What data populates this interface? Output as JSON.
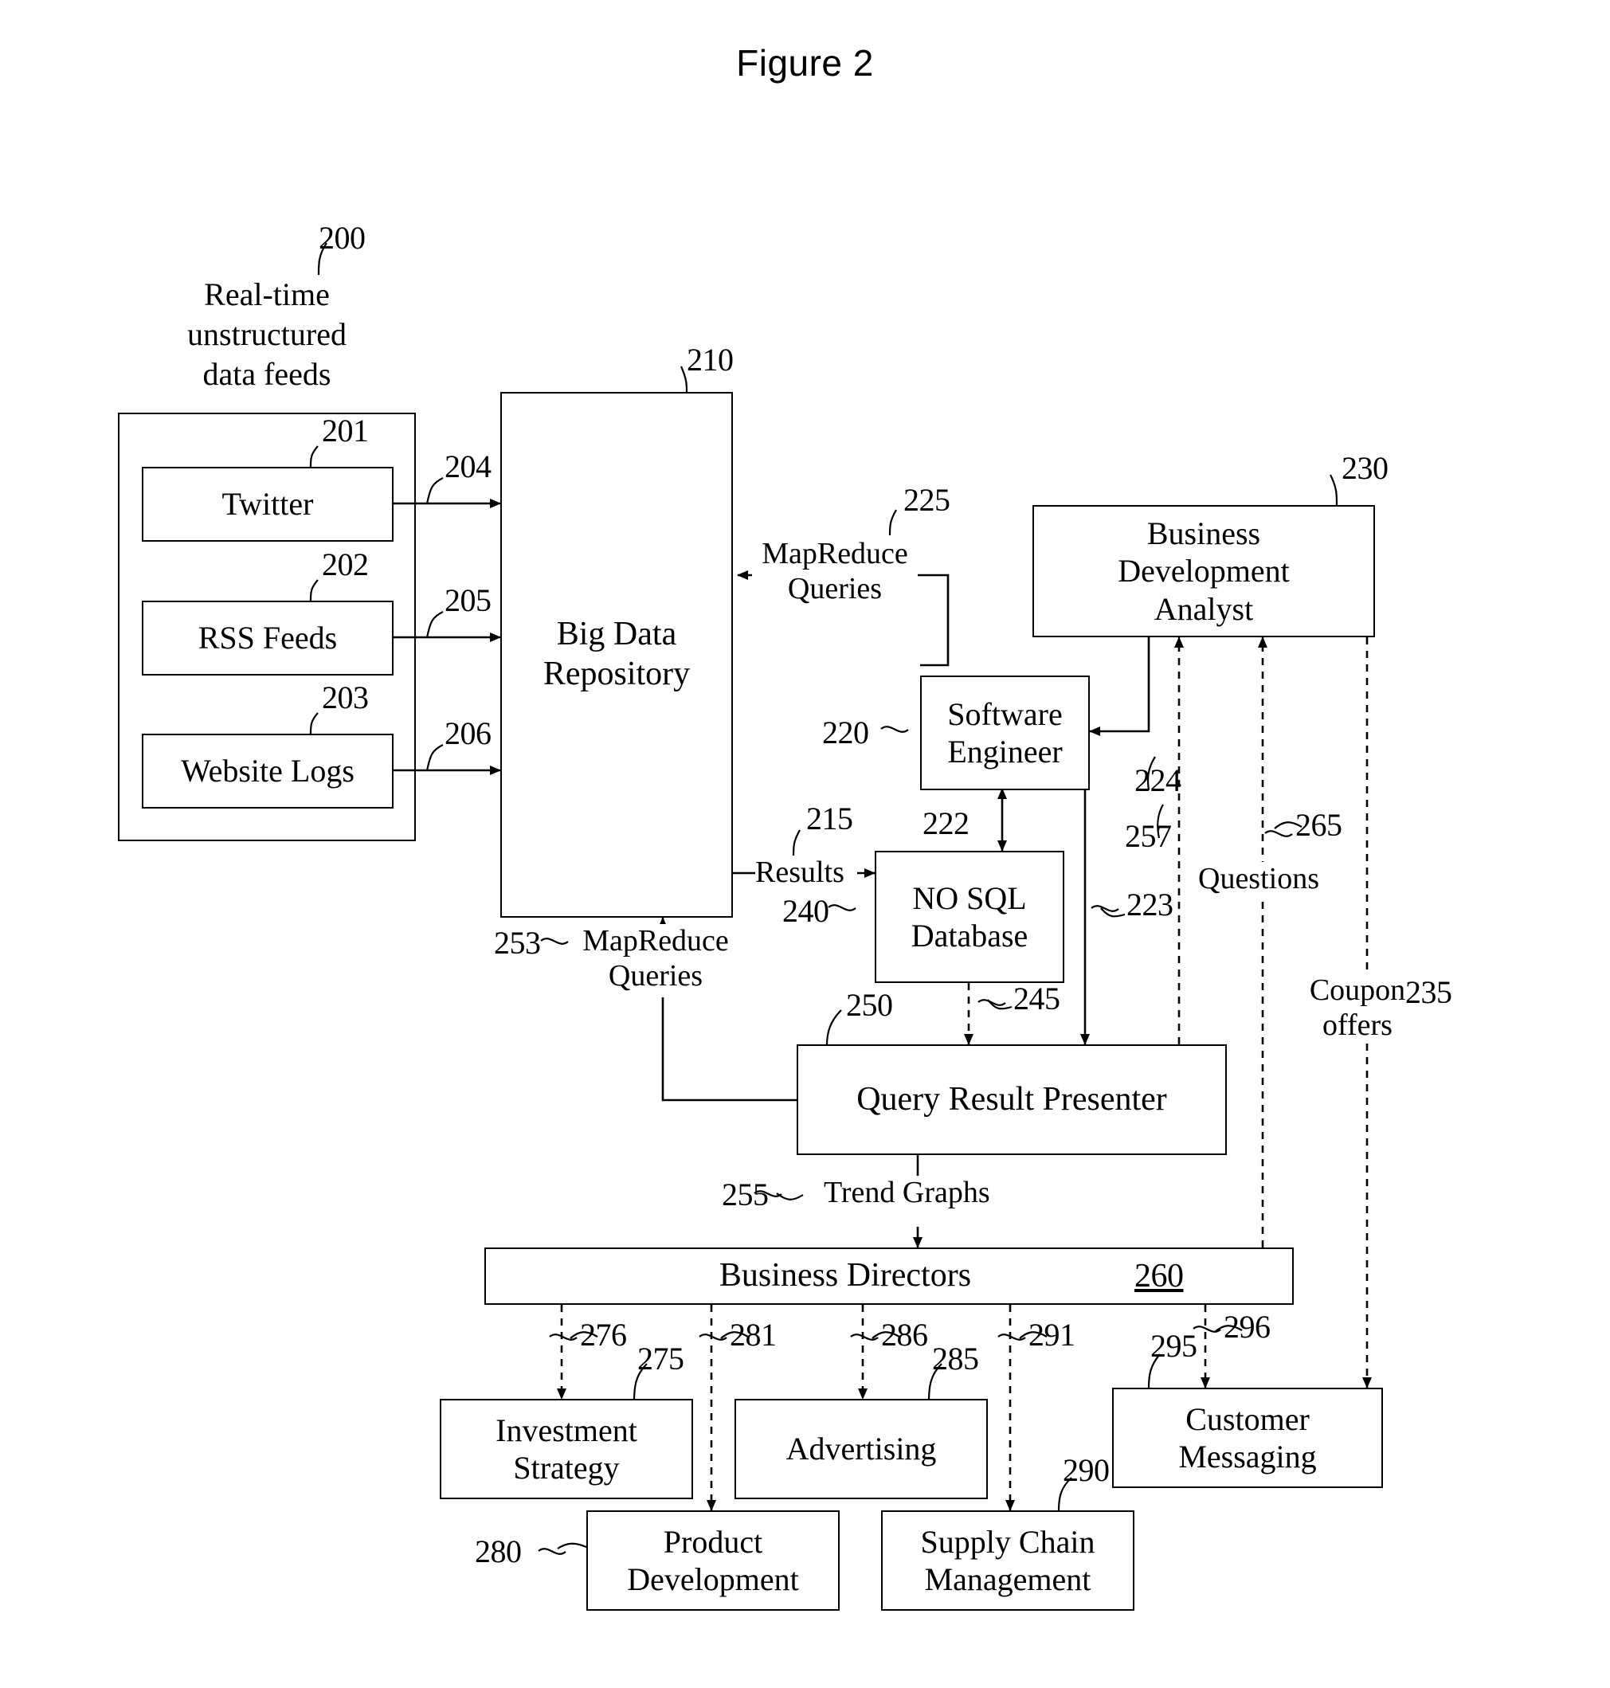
{
  "figure": {
    "title": "Figure 2"
  },
  "groups": [
    {
      "id": "feeds",
      "ref": "200",
      "title": "Real-time\nunstructured\ndata feeds"
    }
  ],
  "nodes": [
    {
      "id": "twitter",
      "label": "Twitter",
      "ref": "201"
    },
    {
      "id": "rss",
      "label": "RSS Feeds",
      "ref": "202"
    },
    {
      "id": "weblogs",
      "label": "Website Logs",
      "ref": "203"
    },
    {
      "id": "bigdata",
      "label": "Big Data\nRepository",
      "ref": "210"
    },
    {
      "id": "bda",
      "label": "Business\nDevelopment\nAnalyst",
      "ref": "230"
    },
    {
      "id": "swe",
      "label": "Software\nEngineer",
      "ref": "220"
    },
    {
      "id": "nosql",
      "label": "NO SQL\nDatabase",
      "ref": "240"
    },
    {
      "id": "qrp",
      "label": "Query Result Presenter",
      "ref": "250"
    },
    {
      "id": "bizdir",
      "label": "Business Directors",
      "ref": "260"
    },
    {
      "id": "invest",
      "label": "Investment\nStrategy",
      "ref": "275"
    },
    {
      "id": "prod",
      "label": "Product\nDevelopment",
      "ref": "280"
    },
    {
      "id": "advert",
      "label": "Advertising",
      "ref": "285"
    },
    {
      "id": "supply",
      "label": "Supply Chain\nManagement",
      "ref": "290"
    },
    {
      "id": "custmsg",
      "label": "Customer\nMessaging",
      "ref": "295"
    }
  ],
  "edge_refs": {
    "twitter_to_bigdata": "204",
    "rss_to_bigdata": "205",
    "weblogs_to_bigdata": "206",
    "bigdata_to_nosql": "215",
    "swe_nosql": "222",
    "swe_to_qrp": "223",
    "bda_to_swe": "224",
    "swe_to_bigdata": "225",
    "bda_to_custmsg": "235",
    "nosql_to_qrp": "245",
    "qrp_to_bigdata": "253",
    "qrp_to_bizdir": "255",
    "qrp_to_bda": "257",
    "bizdir_to_bda": "265",
    "bizdir_to_invest": "276",
    "bizdir_to_prod": "281",
    "bizdir_to_advert": "286",
    "bizdir_to_supply": "291",
    "bizdir_to_custmsg": "296"
  },
  "edge_labels": {
    "mapreduce_queries_225": "MapReduce\nQueries",
    "results_215": "Results",
    "mapreduce_queries_253": "MapReduce\nQueries",
    "trend_graphs_255": "Trend Graphs",
    "questions_265": "Questions",
    "coupon_offers_235": "Coupon\noffers"
  },
  "colors": {
    "ink": "#000000",
    "paper": "#ffffff"
  }
}
